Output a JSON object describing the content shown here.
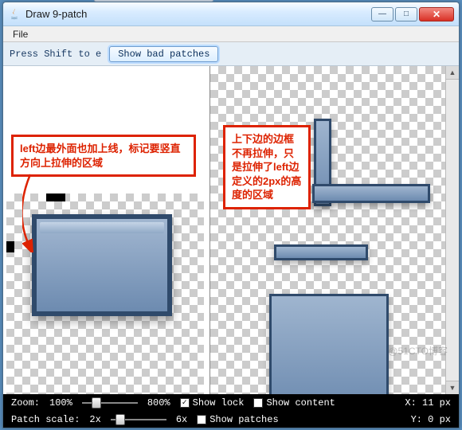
{
  "window": {
    "title": "Draw 9-patch",
    "min_glyph": "—",
    "max_glyph": "□",
    "close_glyph": "✕"
  },
  "menu": {
    "file": "File"
  },
  "toolbar": {
    "hint": "Press Shift to e",
    "show_bad_patches": "Show bad patches"
  },
  "notes": {
    "left": "left边最外面也加上线，标记要竖直方向上拉伸的区域",
    "right": "上下边的边框不再拉伸，只是拉伸了left边定义的2px的高度的区域"
  },
  "status": {
    "zoom_label": "Zoom:",
    "zoom_min": "100%",
    "zoom_max": "800%",
    "patch_scale_label": "Patch scale:",
    "patch_min": "2x",
    "patch_max": "6x",
    "show_lock": "Show lock",
    "show_content": "Show content",
    "show_patches": "Show patches",
    "x_label": "X: 11 px",
    "y_label": "Y: 0 px"
  },
  "watermark": "@51CTO博客"
}
